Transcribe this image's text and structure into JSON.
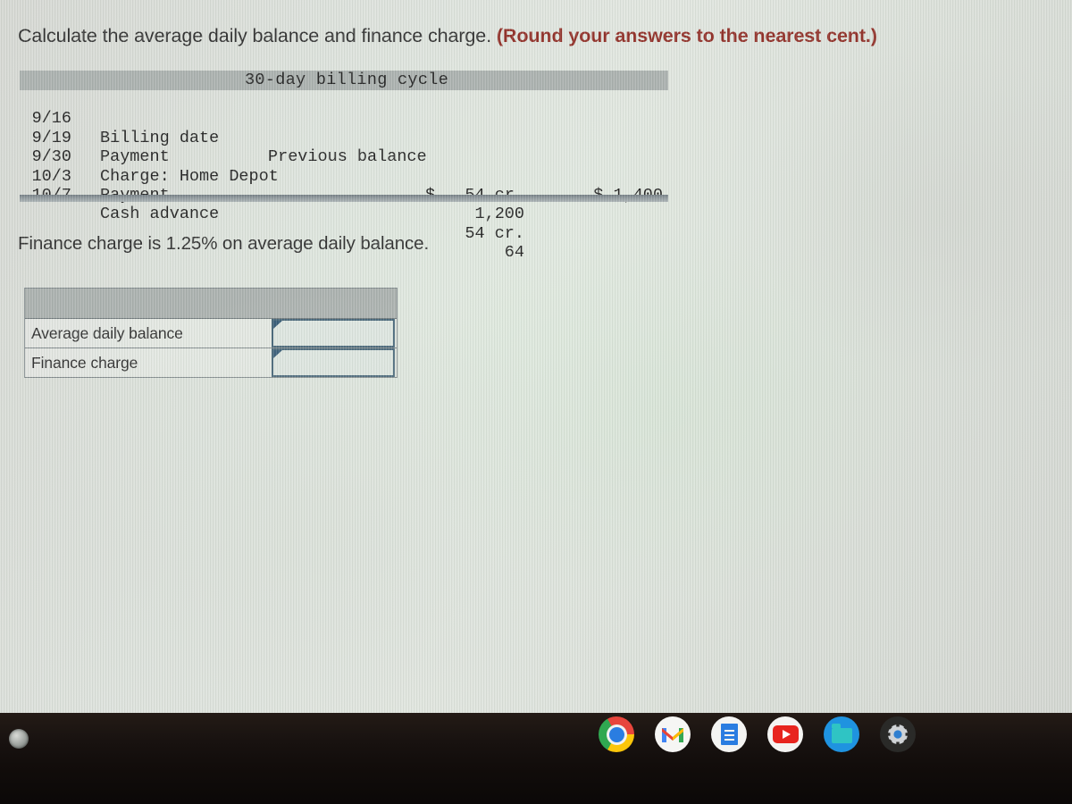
{
  "prompt": {
    "main": "Calculate the average daily balance and finance charge.",
    "hint": "(Round your answers to the nearest cent.)"
  },
  "billing_table": {
    "caption": "30-day billing cycle",
    "rows": [
      {
        "date": "9/16",
        "description": "Billing date",
        "middle": "Previous balance",
        "amount": "",
        "amount_right": "$ 1,400"
      },
      {
        "date": "9/19",
        "description": "Payment",
        "middle": "",
        "amount": "$   54 cr.",
        "amount_right": ""
      },
      {
        "date": "9/30",
        "description": "Charge: Home Depot",
        "middle": "",
        "amount": "1,200",
        "amount_right": ""
      },
      {
        "date": "10/3",
        "description": "Payment",
        "middle": "",
        "amount": "54 cr.",
        "amount_right": ""
      },
      {
        "date": "10/7",
        "description": "Cash advance",
        "middle": "",
        "amount": "64",
        "amount_right": ""
      }
    ]
  },
  "note": "Finance charge is 1.25% on average daily balance.",
  "answer_table": {
    "header_label": "",
    "rows": [
      {
        "label": "Average daily balance",
        "value": "",
        "placeholder": ""
      },
      {
        "label": "Finance charge",
        "value": "",
        "placeholder": ""
      }
    ]
  },
  "shelf": {
    "launcher_label": "Launcher",
    "apps": [
      {
        "name": "chrome-icon",
        "label": "Chrome"
      },
      {
        "name": "gmail-icon",
        "label": "Gmail"
      },
      {
        "name": "docs-icon",
        "label": "Docs"
      },
      {
        "name": "youtube-icon",
        "label": "YouTube"
      },
      {
        "name": "files-icon",
        "label": "Files"
      },
      {
        "name": "settings-icon",
        "label": "Settings"
      }
    ]
  },
  "colors": {
    "screen_bg": "#dde2dc",
    "header_gray": "#a9afad",
    "hint_red": "#8e2a22",
    "text": "#2b2b2b",
    "input_border": "#3f5f73",
    "input_marker": "#2c5270",
    "shelf_bg": "#181210"
  }
}
